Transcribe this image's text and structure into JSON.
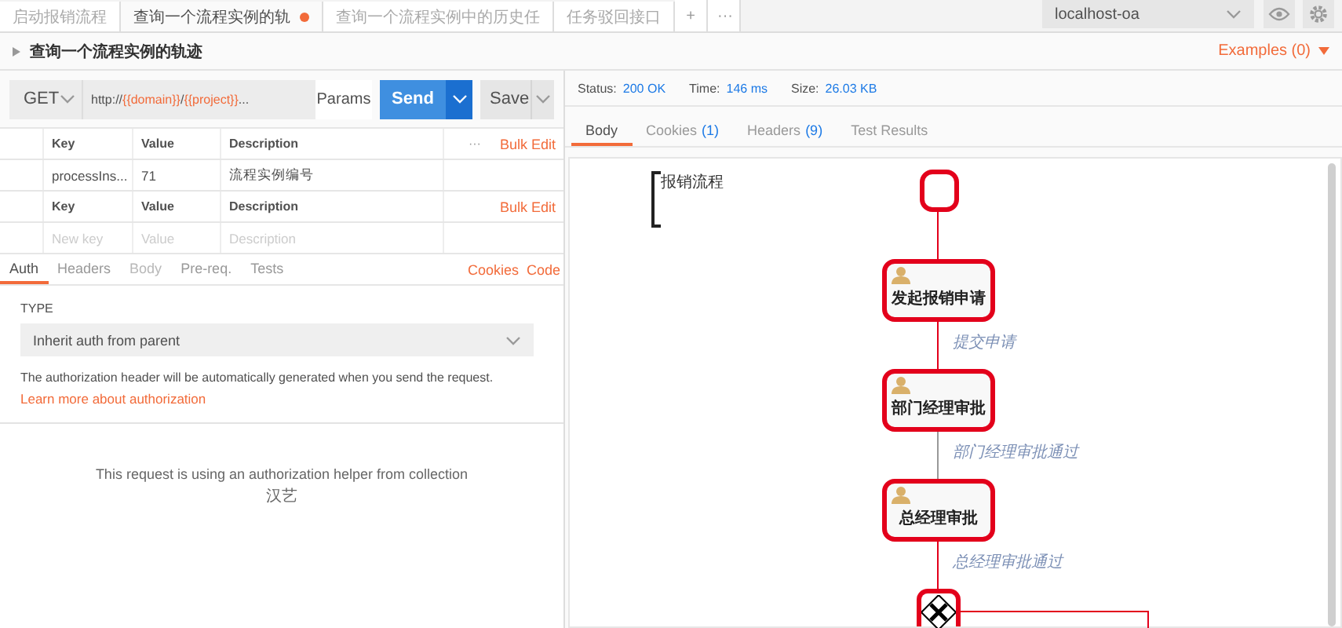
{
  "tabs": [
    {
      "label": "启动报销流程",
      "selected": false,
      "unsaved": false
    },
    {
      "label": "查询一个流程实例的轨",
      "selected": true,
      "unsaved": true
    },
    {
      "label": "查询一个流程实例中的历史任",
      "selected": false,
      "unsaved": false
    },
    {
      "label": "任务驳回接口",
      "selected": false,
      "unsaved": false
    }
  ],
  "tab_actions": [
    "+",
    "···"
  ],
  "environment": {
    "value": "localhost-oa"
  },
  "request_title": "查询一个流程实例的轨迹",
  "examples": "Examples (0)",
  "request": {
    "method": "GET",
    "url": [
      {
        "text": "http://",
        "kind": "plain"
      },
      {
        "text": "{{domain}}",
        "kind": "variable"
      },
      {
        "text": "/",
        "kind": "plain"
      },
      {
        "text": "{{project}}",
        "kind": "variable"
      },
      {
        "text": "...",
        "kind": "plain"
      }
    ],
    "params_button": "Params",
    "send_button": "Send",
    "save_button": "Save"
  },
  "params_tables": [
    {
      "columns": [
        "Key",
        "Value",
        "Description"
      ],
      "more": "···",
      "bulk_edit": "Bulk Edit",
      "rows": [
        [
          "processIns...",
          "71",
          "流程实例编号"
        ]
      ]
    },
    {
      "columns": [
        "Key",
        "Value",
        "Description"
      ],
      "bulk_edit": "Bulk Edit",
      "placeholders": [
        "New key",
        "Value",
        "Description"
      ]
    }
  ],
  "request_tabs": [
    {
      "label": "Auth",
      "selected": true,
      "disabled": false
    },
    {
      "label": "Headers",
      "selected": false,
      "disabled": false
    },
    {
      "label": "Body",
      "selected": false,
      "disabled": true
    },
    {
      "label": "Pre-req.",
      "selected": false,
      "disabled": false
    },
    {
      "label": "Tests",
      "selected": false,
      "disabled": false
    }
  ],
  "request_links": [
    "Cookies",
    "Code"
  ],
  "auth": {
    "type_label": "TYPE",
    "type_value": "Inherit auth from parent",
    "note": "The authorization header will be automatically generated when you send the request.",
    "link": "Learn more about authorization",
    "helper_text": "This request is using an authorization helper from collection",
    "collection": "汉艺"
  },
  "response": {
    "stats": [
      {
        "label": "Status:",
        "value": "200 OK"
      },
      {
        "label": "Time:",
        "value": "146 ms"
      },
      {
        "label": "Size:",
        "value": "26.03 KB"
      }
    ],
    "tabs": [
      {
        "label": "Body",
        "selected": true
      },
      {
        "label": "Cookies",
        "count": "(1)",
        "selected": false
      },
      {
        "label": "Headers",
        "count": "(9)",
        "selected": false
      },
      {
        "label": "Test Results",
        "selected": false
      }
    ]
  },
  "diagram": {
    "lane_label": "报销流程",
    "flow": [
      {
        "kind": "start",
        "highlighted": true
      },
      {
        "kind": "edge",
        "traversed": true
      },
      {
        "kind": "task",
        "label": "发起报销申请",
        "highlighted": true
      },
      {
        "kind": "edge",
        "label": "提交申请",
        "traversed": true
      },
      {
        "kind": "task",
        "label": "部门经理审批",
        "highlighted": true
      },
      {
        "kind": "edge",
        "label": "部门经理审批通过",
        "traversed": false
      },
      {
        "kind": "task",
        "label": "总经理审批",
        "highlighted": true
      },
      {
        "kind": "edge",
        "label": "总经理审批通过",
        "traversed": true
      },
      {
        "kind": "gateway",
        "highlighted": true
      }
    ]
  }
}
